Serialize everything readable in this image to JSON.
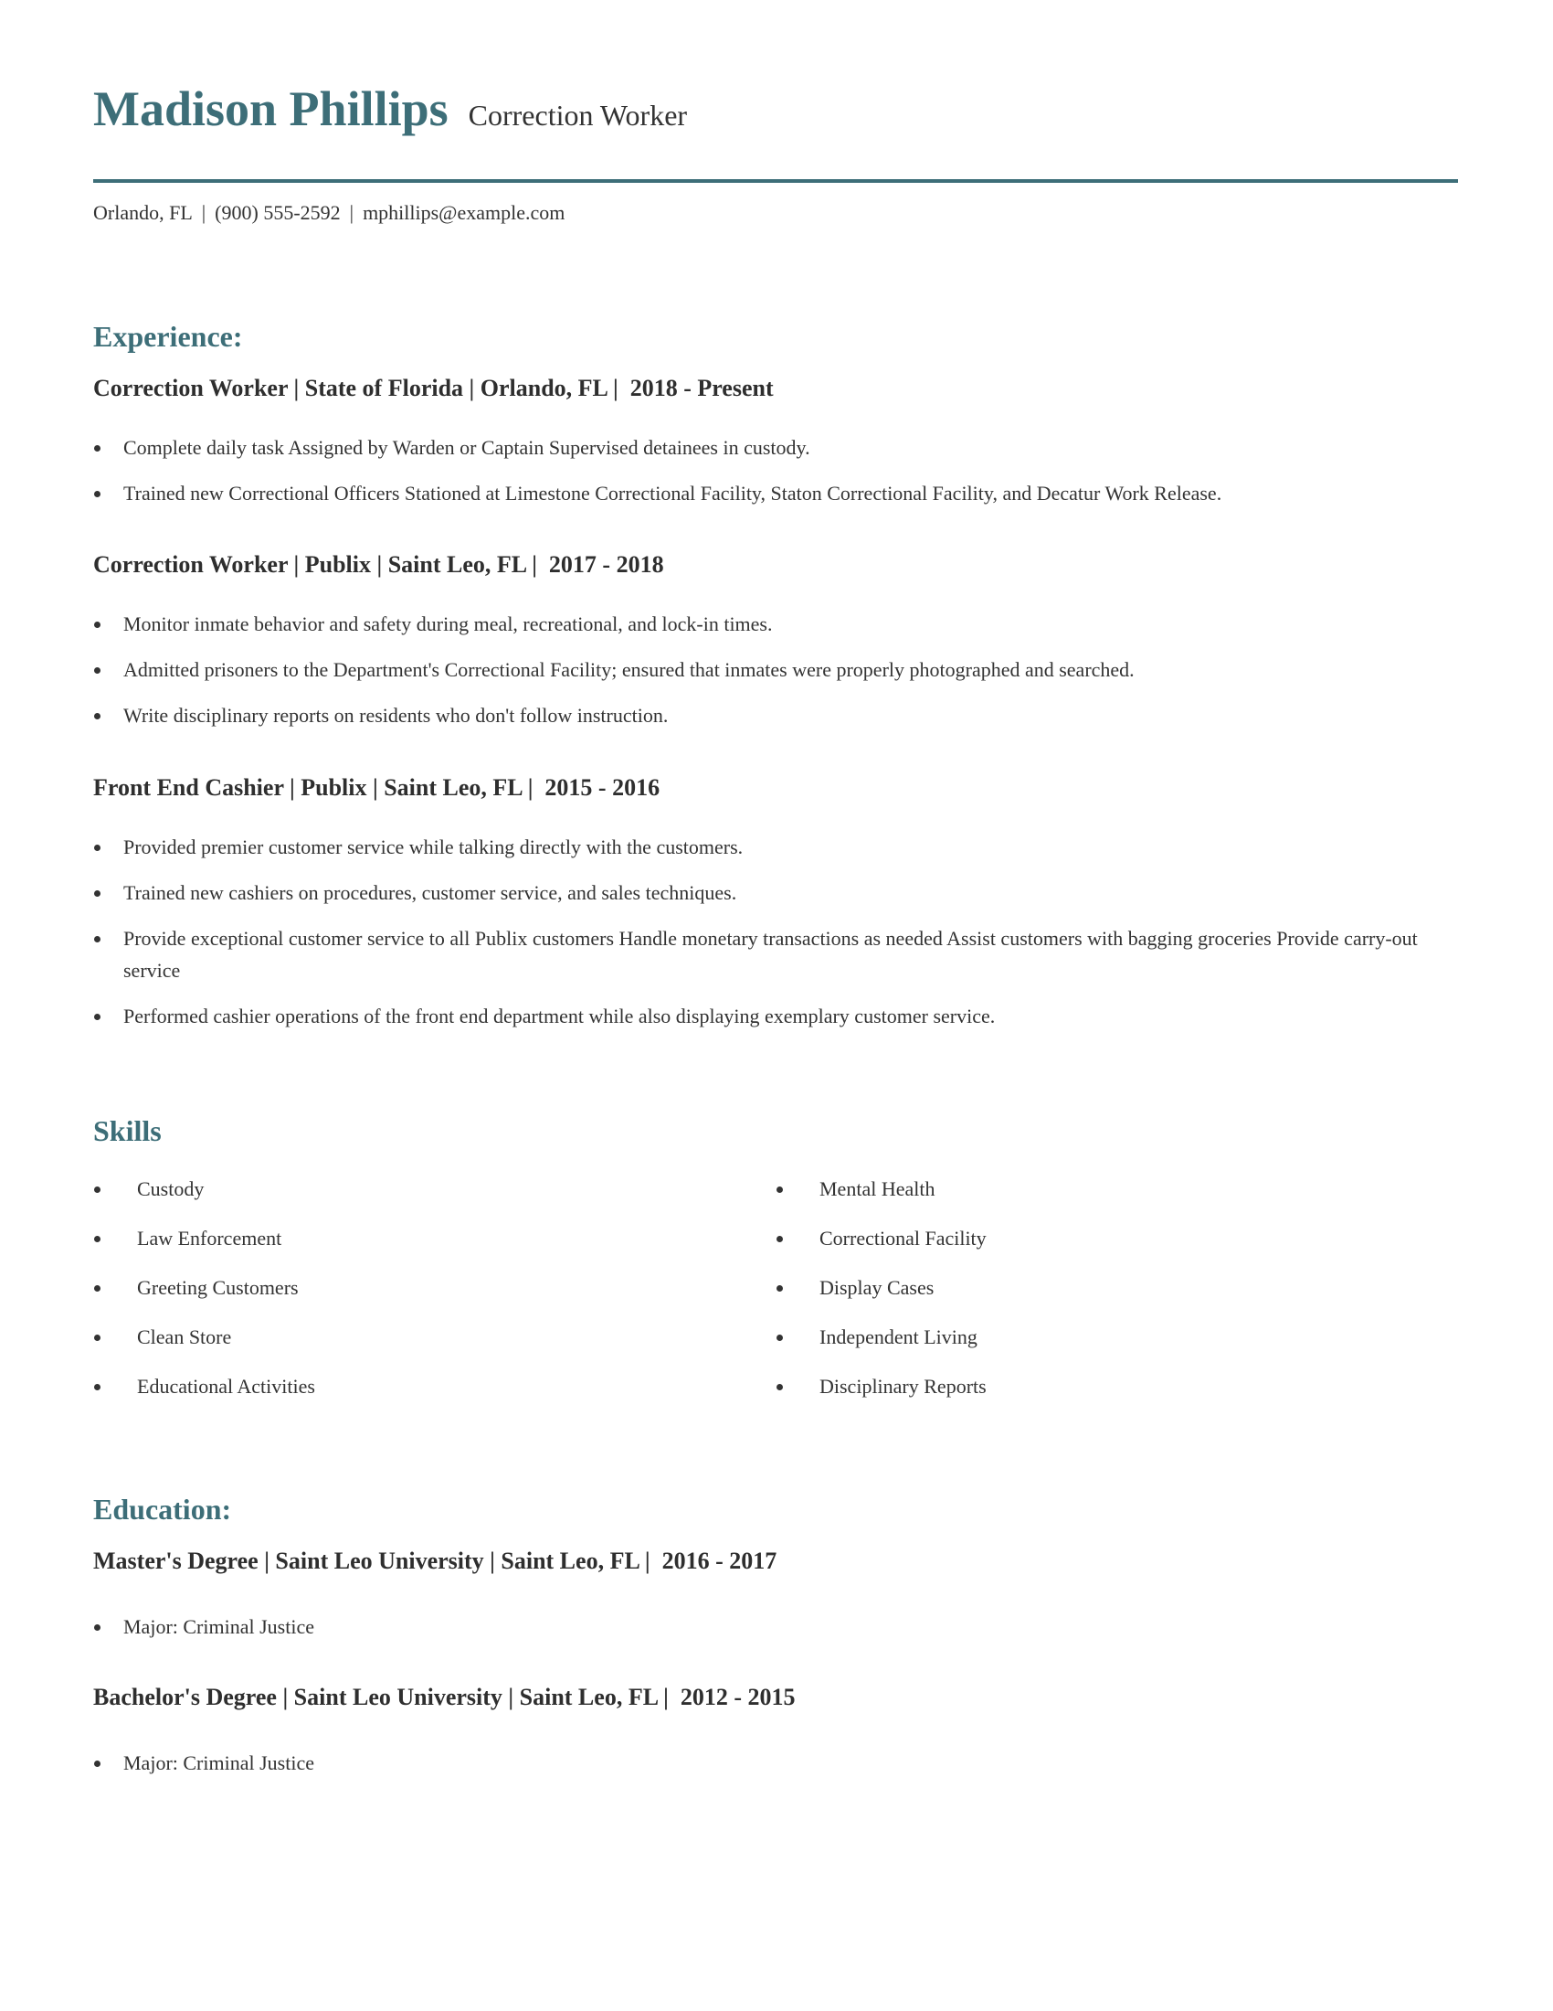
{
  "header": {
    "name": "Madison Phillips",
    "title": "Correction Worker",
    "contact": {
      "location": "Orlando, FL",
      "phone": "(900) 555-2592",
      "email": "mphillips@example.com",
      "separator": "|"
    }
  },
  "colors": {
    "accent": "#3d6e78",
    "text": "#333333"
  },
  "experience": {
    "heading": "Experience:",
    "jobs": [
      {
        "title": "Correction Worker | State of Florida | Orlando, FL |  2018 - Present",
        "bullets": [
          "Complete daily task Assigned by Warden or Captain Supervised detainees in custody.",
          "Trained new Correctional Officers Stationed at Limestone Correctional Facility, Staton Correctional Facility, and Decatur Work Release."
        ]
      },
      {
        "title": "Correction Worker | Publix | Saint Leo, FL |  2017 - 2018",
        "bullets": [
          "Monitor inmate behavior and safety during meal, recreational, and lock-in times.",
          "Admitted prisoners to the Department's Correctional Facility; ensured that inmates were properly photographed and searched.",
          "Write disciplinary reports on residents who don't follow instruction."
        ]
      },
      {
        "title": "Front End Cashier | Publix | Saint Leo, FL |  2015 - 2016",
        "bullets": [
          "Provided premier customer service while talking directly with the customers.",
          "Trained new cashiers on procedures, customer service, and sales techniques.",
          "Provide exceptional customer service to all Publix customers Handle monetary transactions as needed Assist customers with bagging groceries Provide carry-out service",
          "Performed cashier operations of the front end department while also displaying exemplary customer service."
        ]
      }
    ]
  },
  "skills": {
    "heading": "Skills",
    "left": [
      "Custody",
      "Law Enforcement",
      "Greeting Customers",
      "Clean Store",
      "Educational Activities"
    ],
    "right": [
      "Mental Health",
      "Correctional Facility",
      "Display Cases",
      "Independent Living",
      "Disciplinary Reports"
    ]
  },
  "education": {
    "heading": "Education:",
    "degrees": [
      {
        "title": "Master's Degree | Saint Leo University | Saint Leo, FL |  2016 - 2017",
        "bullets": [
          "Major: Criminal Justice"
        ]
      },
      {
        "title": "Bachelor's Degree | Saint Leo University | Saint Leo, FL |  2012 - 2015",
        "bullets": [
          "Major: Criminal Justice"
        ]
      }
    ]
  }
}
